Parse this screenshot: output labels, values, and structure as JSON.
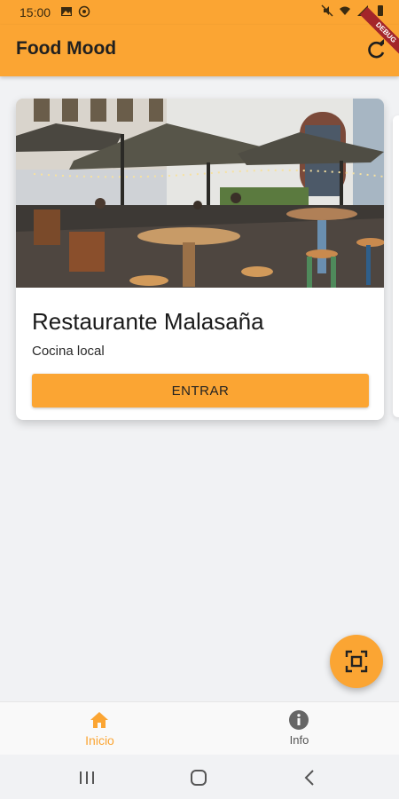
{
  "status_bar": {
    "time": "15:00",
    "left_icons": [
      "image-icon",
      "whatsapp-icon"
    ],
    "right_icons": [
      "mute-icon",
      "wifi-icon",
      "signal-icon",
      "battery-icon"
    ]
  },
  "app_bar": {
    "title": "Food Mood",
    "action_icon": "refresh-icon",
    "debug_banner": "DEBUG"
  },
  "restaurants": [
    {
      "name": "Restaurante Malasaña",
      "cuisine": "Cocina local",
      "button_label": "ENTRAR",
      "image": "restaurant-terrace-photo"
    }
  ],
  "fab": {
    "icon": "scan-icon"
  },
  "bottom_nav": {
    "items": [
      {
        "label": "Inicio",
        "icon": "home-icon",
        "active": true
      },
      {
        "label": "Info",
        "icon": "info-icon",
        "active": false
      }
    ]
  },
  "colors": {
    "accent": "#fba533",
    "background": "#f1f2f4",
    "card": "#ffffff"
  }
}
